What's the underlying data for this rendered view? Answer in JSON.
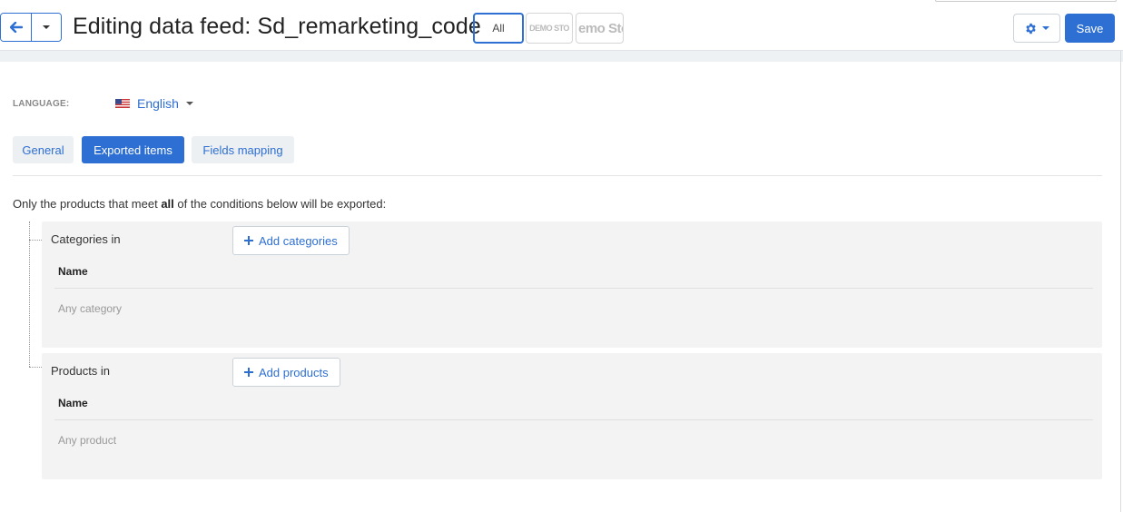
{
  "header": {
    "title": "Editing data feed: Sd_remarketing_code",
    "stores": {
      "all": "All",
      "demo_small": "DEMO STO",
      "demo_large": "emo Sto"
    },
    "save_label": "Save"
  },
  "language": {
    "label": "LANGUAGE:",
    "selected": "English",
    "flag_icon": "us-flag-icon"
  },
  "tabs": [
    {
      "label": "General",
      "active": false
    },
    {
      "label": "Exported items",
      "active": true
    },
    {
      "label": "Fields mapping",
      "active": false
    }
  ],
  "conditions": {
    "intro_before": "Only the products that meet ",
    "intro_bold": "all",
    "intro_after": " of the conditions below will be exported:",
    "blocks": [
      {
        "title": "Categories in",
        "add_label": "Add categories",
        "column": "Name",
        "empty": "Any category"
      },
      {
        "title": "Products in",
        "add_label": "Add products",
        "column": "Name",
        "empty": "Any product"
      }
    ]
  },
  "colors": {
    "accent": "#2d6fd2",
    "panel": "#f3f3f3",
    "tab_inactive": "#edf0f3"
  }
}
